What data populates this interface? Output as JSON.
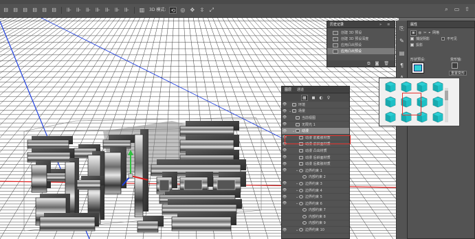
{
  "options_bar": {
    "mode_label": "3D 模式:",
    "icons": [
      "align-icon",
      "align-icon",
      "align-icon",
      "align-icon",
      "align-icon",
      "align-icon",
      "distribute-icon",
      "distribute-icon",
      "distribute-icon",
      "distribute-icon",
      "distribute-icon",
      "distribute-icon",
      "distribute-icon",
      "auto-align-icon"
    ],
    "mode_icons": [
      "rotate-3d-icon",
      "roll-3d-icon",
      "drag-3d-icon",
      "slide-3d-icon",
      "scale-3d-icon"
    ],
    "right_icons": [
      "search-icon",
      "workspace-icon",
      "share-icon"
    ]
  },
  "history": {
    "tabs": [
      "历史记录",
      "»",
      "≡"
    ],
    "items": [
      {
        "label": "创建 3D 预设",
        "selected": false
      },
      {
        "label": "创建 3D 预设深度",
        "selected": false
      },
      {
        "label": "应用凸出预设",
        "selected": false
      },
      {
        "label": "应用凸出预设",
        "selected": true
      }
    ],
    "bottom_icons": [
      "new-snapshot-icon",
      "camera-icon",
      "trash-icon"
    ]
  },
  "properties": {
    "tab": "属性",
    "mesh_label": "网格",
    "checkbox_shadow": "捕捉阴影",
    "checkbox_invisible": "不可见",
    "checkbox_cast": "投影",
    "shape_preset_label": "形状预设:",
    "deform_label": "变形轴:",
    "reset_label": "重置变形",
    "gear": "⚙"
  },
  "layers": {
    "tabs": [
      "图层",
      "通道"
    ],
    "selected_name": "动漫",
    "rows": [
      {
        "name": "环境",
        "indent": 0,
        "kind": "env",
        "eye": "●"
      },
      {
        "name": "场景",
        "indent": 0,
        "kind": "scene",
        "eye": "●"
      },
      {
        "name": "当前视图",
        "indent": 1,
        "kind": "camera",
        "eye": "●"
      },
      {
        "name": "无限光 1",
        "indent": 1,
        "kind": "light",
        "eye": "●"
      },
      {
        "name": "动漫",
        "indent": 1,
        "kind": "mesh",
        "eye": "●",
        "selected": true
      },
      {
        "name": "动漫 前膨胀材质",
        "indent": 2,
        "kind": "mat",
        "eye": "●"
      },
      {
        "name": "动漫 前斜面材质",
        "indent": 2,
        "kind": "mat",
        "eye": "●"
      },
      {
        "name": "动漫 凸出材质",
        "indent": 2,
        "kind": "mat",
        "eye": "●"
      },
      {
        "name": "动漫 后斜面材质",
        "indent": 2,
        "kind": "mat",
        "eye": "●"
      },
      {
        "name": "动漫 后膨胀材质",
        "indent": 2,
        "kind": "mat",
        "eye": "●"
      },
      {
        "name": "边界约束 1",
        "indent": 2,
        "kind": "group",
        "eye": "●"
      },
      {
        "name": "内部约束 2",
        "indent": 3,
        "kind": "constraint",
        "eye": ""
      },
      {
        "name": "边界约束 3",
        "indent": 2,
        "kind": "group",
        "eye": "●"
      },
      {
        "name": "边界约束 4",
        "indent": 2,
        "kind": "group",
        "eye": "●"
      },
      {
        "name": "边界约束 5",
        "indent": 2,
        "kind": "group",
        "eye": "●"
      },
      {
        "name": "边界约束 6",
        "indent": 2,
        "kind": "group",
        "eye": "●"
      },
      {
        "name": "内部约束 7",
        "indent": 3,
        "kind": "constraint",
        "eye": ""
      },
      {
        "name": "内部约束 8",
        "indent": 3,
        "kind": "constraint",
        "eye": ""
      },
      {
        "name": "内部约束 9",
        "indent": 3,
        "kind": "constraint",
        "eye": ""
      },
      {
        "name": "边界约束 10",
        "indent": 2,
        "kind": "group",
        "eye": "●"
      }
    ]
  },
  "preset_popup": {
    "selected_index": 4,
    "count": 12
  },
  "canvas": {
    "text_3d": "动漫",
    "accent": "#e5322d",
    "axis_x": "#e02020",
    "axis_y": "#2040e0",
    "axis_z": "#30c040",
    "ground": "#ffffff"
  }
}
